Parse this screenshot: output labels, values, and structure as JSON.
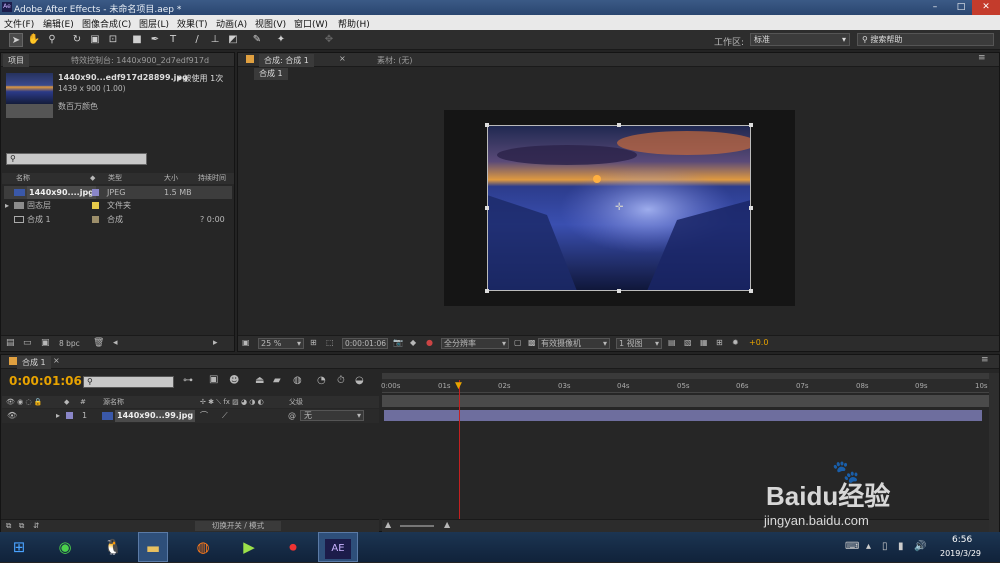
{
  "window": {
    "title": "Adobe After Effects - 未命名项目.aep *",
    "app_icon": "Ae"
  },
  "menu": [
    "文件(F)",
    "编辑(E)",
    "图像合成(C)",
    "图层(L)",
    "效果(T)",
    "动画(A)",
    "视图(V)",
    "窗口(W)",
    "帮助(H)"
  ],
  "toolbar": {
    "workspace_label": "工作区:",
    "workspace_value": "标准",
    "search_placeholder": "搜索帮助"
  },
  "project_panel": {
    "tabs": [
      "项目",
      "特效控制台: 1440x900_2d7edf917d"
    ],
    "selected_file": "1440x90...edf917d28899.jpg",
    "usage": "▾ 被使用 1次",
    "dimensions": "1439 x 900 (1.00)",
    "colors": "数百万颜色",
    "columns": [
      "名称",
      "类型",
      "大小",
      "持续时间"
    ],
    "items": [
      {
        "name": "1440x90....jpg",
        "type": "JPEG",
        "size": "1.5 MB",
        "duration": "",
        "color": "#8a86c8"
      },
      {
        "name": "固态层",
        "type": "文件夹",
        "size": "",
        "duration": "",
        "color": "#e6c94a"
      },
      {
        "name": "合成 1",
        "type": "合成",
        "size": "",
        "duration": "? 0:00",
        "color": "#9c8e6a"
      }
    ],
    "bit_depth": "8 bpc"
  },
  "comp_panel": {
    "tabs": [
      "合成: 合成 1",
      "素材: (无)"
    ],
    "subtab": "合成 1",
    "zoom": "25 %",
    "timecode": "0:00:01:06",
    "resolution": "全分辨率",
    "camera": "有效摄像机",
    "views": "1 视图",
    "exposure": "+0.0"
  },
  "timeline": {
    "tab": "合成 1",
    "timecode": "0:00:01:06",
    "ticks": [
      "0:00s",
      "01s",
      "02s",
      "03s",
      "04s",
      "05s",
      "06s",
      "07s",
      "08s",
      "09s",
      "10s"
    ],
    "col_headers": [
      "#",
      "源名称",
      "父级"
    ],
    "layer": {
      "index": "1",
      "name": "1440x90...99.jpg",
      "parent": "无"
    },
    "footer": "切换开关 / 模式"
  },
  "taskbar": {
    "time": "6:56",
    "date": "2019/3/29",
    "ae_label": "AE"
  },
  "watermark": {
    "text": "Baidu经验",
    "url": "jingyan.baidu.com"
  },
  "colors": {
    "accent": "#e8a300",
    "playhead": "#c42020",
    "layer_bar": "#6e6e9e"
  }
}
